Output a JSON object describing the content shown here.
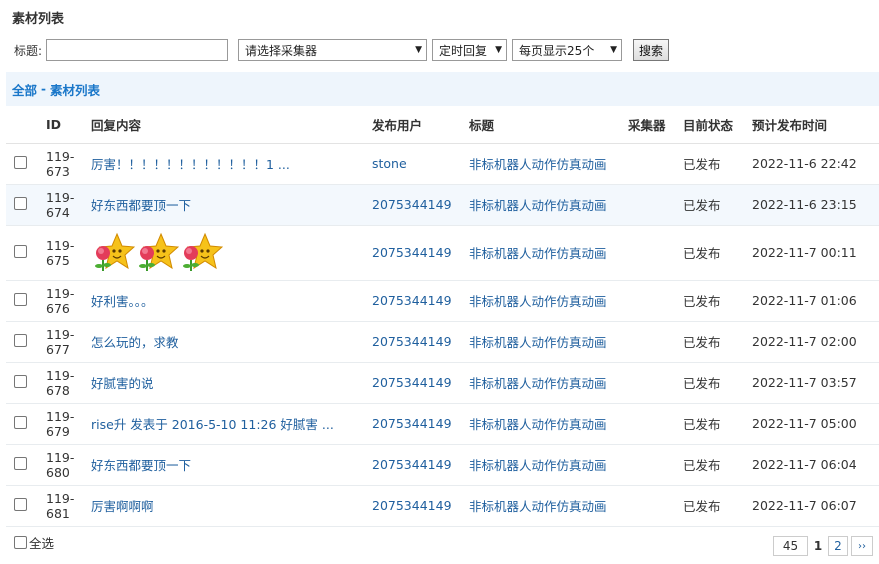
{
  "page": {
    "title": "素材列表"
  },
  "filters": {
    "title_label": "标题:",
    "title_value": "",
    "collector_selected": "请选择采集器",
    "type_selected": "定时回复",
    "page_size_selected": "每页显示25个",
    "search_label": "搜索"
  },
  "breadcrumb": {
    "root": "全部",
    "sep": "-",
    "current": "素材列表"
  },
  "table": {
    "headers": [
      "ID",
      "回复内容",
      "发布用户",
      "标题",
      "采集器",
      "目前状态",
      "预计发布时间"
    ],
    "rows": [
      {
        "id_a": "119-",
        "id_b": "673",
        "content": "厉害！！！！！！！！！！！！1 ...",
        "user": "stone",
        "title": "非标机器人动作仿真动画",
        "collector": "",
        "status": "已发布",
        "time": "2022-11-6 22:42"
      },
      {
        "id_a": "119-",
        "id_b": "674",
        "content": "好东西都要顶一下",
        "user": "2075344149",
        "title": "非标机器人动作仿真动画",
        "collector": "",
        "status": "已发布",
        "time": "2022-11-6 23:15"
      },
      {
        "id_a": "119-",
        "id_b": "675",
        "content": "",
        "user": "2075344149",
        "title": "非标机器人动作仿真动画",
        "collector": "",
        "status": "已发布",
        "time": "2022-11-7 00:11"
      },
      {
        "id_a": "119-",
        "id_b": "676",
        "content": "好利害。。。",
        "user": "2075344149",
        "title": "非标机器人动作仿真动画",
        "collector": "",
        "status": "已发布",
        "time": "2022-11-7 01:06"
      },
      {
        "id_a": "119-",
        "id_b": "677",
        "content": "怎么玩的，求教",
        "user": "2075344149",
        "title": "非标机器人动作仿真动画",
        "collector": "",
        "status": "已发布",
        "time": "2022-11-7 02:00"
      },
      {
        "id_a": "119-",
        "id_b": "678",
        "content": "好腻害的说",
        "user": "2075344149",
        "title": "非标机器人动作仿真动画",
        "collector": "",
        "status": "已发布",
        "time": "2022-11-7 03:57"
      },
      {
        "id_a": "119-",
        "id_b": "679",
        "content": "rise升 发表于 2016-5-10 11:26 好腻害 ...",
        "user": "2075344149",
        "title": "非标机器人动作仿真动画",
        "collector": "",
        "status": "已发布",
        "time": "2022-11-7 05:00"
      },
      {
        "id_a": "119-",
        "id_b": "680",
        "content": "好东西都要顶一下",
        "user": "2075344149",
        "title": "非标机器人动作仿真动画",
        "collector": "",
        "status": "已发布",
        "time": "2022-11-7 06:04"
      },
      {
        "id_a": "119-",
        "id_b": "681",
        "content": "厉害啊啊啊",
        "user": "2075344149",
        "title": "非标机器人动作仿真动画",
        "collector": "",
        "status": "已发布",
        "time": "2022-11-7 06:07"
      }
    ]
  },
  "footer": {
    "select_all_label": "全选"
  },
  "pager": {
    "total": "45",
    "current": "1",
    "next_page": "2",
    "next_label": "››"
  },
  "colors": {
    "link": "#1f5f9e",
    "crumb": "#1a77c9",
    "crumb_bg": "#eef5fc",
    "row_highlight": "#f3f8fd"
  },
  "icons": {
    "row3_content": "flower-star-emoticon"
  }
}
